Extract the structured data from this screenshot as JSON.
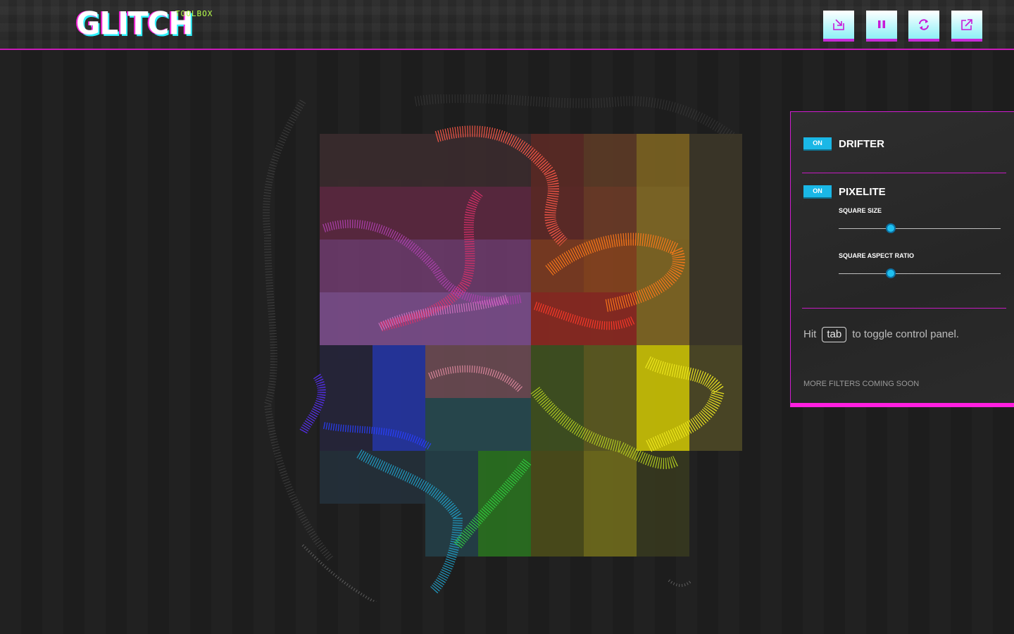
{
  "header": {
    "logo_text": "GLITCH",
    "logo_sub": "TOOLBOX",
    "buttons": [
      {
        "name": "save-image-button",
        "icon": "download-icon"
      },
      {
        "name": "pause-button",
        "icon": "pause-icon"
      },
      {
        "name": "refresh-button",
        "icon": "refresh-icon"
      },
      {
        "name": "share-button",
        "icon": "external-link-icon"
      }
    ]
  },
  "panel": {
    "filters": [
      {
        "name": "DRIFTER",
        "toggle": "ON"
      },
      {
        "name": "PIXELITE",
        "toggle": "ON",
        "sliders": [
          {
            "label": "SQUARE SIZE",
            "value": 0.32
          },
          {
            "label": "SQUARE ASPECT RATIO",
            "value": 0.32
          }
        ]
      }
    ],
    "hint_before": "Hit",
    "hint_key": "tab",
    "hint_after": "to toggle control panel.",
    "coming_soon": "MORE FILTERS COMING SOON"
  },
  "colors": {
    "accent_magenta": "#ff1fe0",
    "toggle_cyan": "#1ab7e6",
    "logo_green": "#b7ff4a"
  }
}
